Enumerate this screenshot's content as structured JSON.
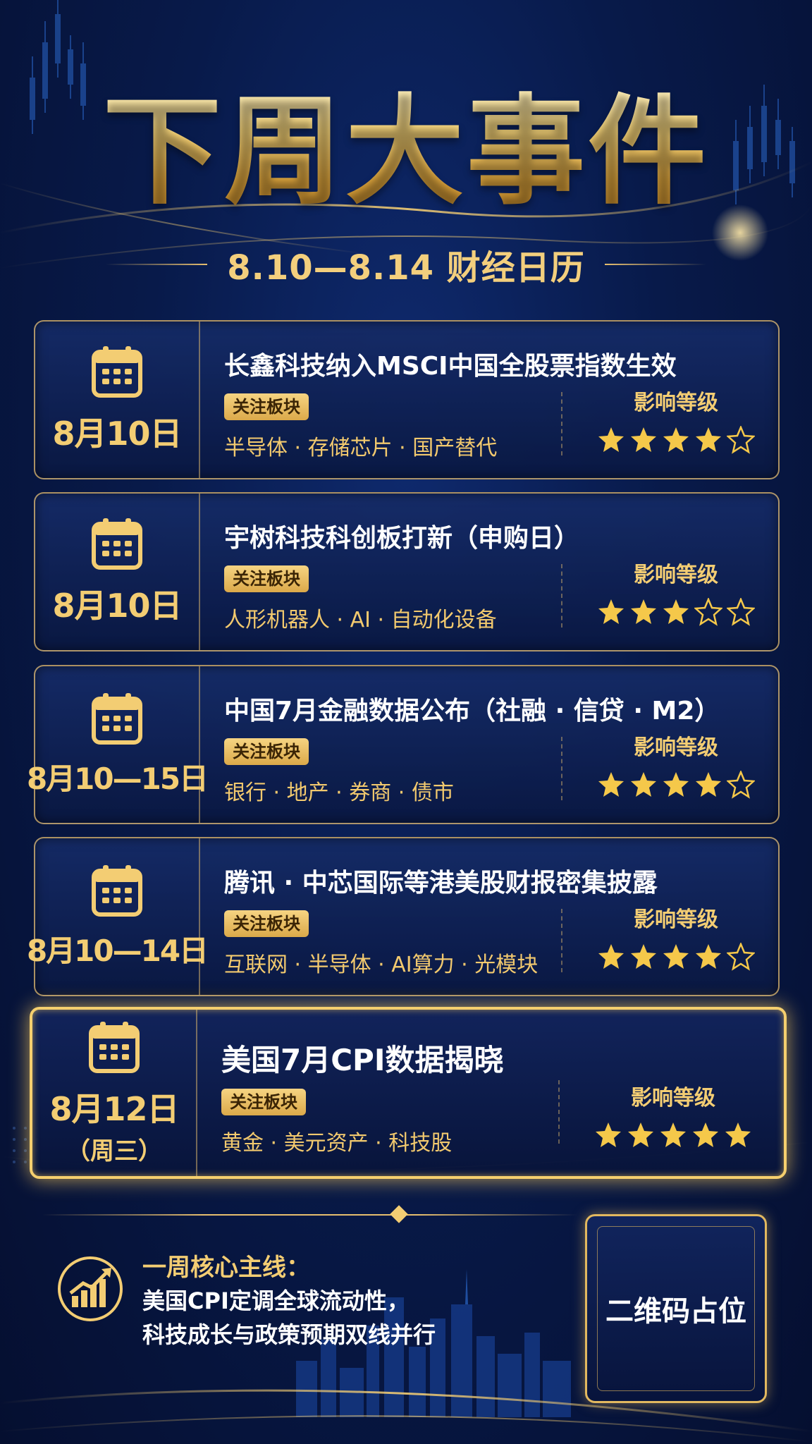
{
  "header": {
    "title": "下周大事件",
    "subtitle": "8.10—8.14 财经日历"
  },
  "events": [
    {
      "date": "8月10日",
      "date_sub": "",
      "title": "长鑫科技纳入MSCI中国全股票指数生效",
      "tag": "关注板块",
      "sectors": "半导体 · 存储芯片 · 国产替代",
      "impact_label": "影响等级",
      "rating": 4,
      "rating_max": 5
    },
    {
      "date": "8月10日",
      "date_sub": "",
      "title": "宇树科技科创板打新（申购日）",
      "tag": "关注板块",
      "sectors": "人形机器人 · AI · 自动化设备",
      "impact_label": "影响等级",
      "rating": 3,
      "rating_max": 5
    },
    {
      "date": "8月10—15日",
      "date_sub": "",
      "title": "中国7月金融数据公布（社融 · 信贷 · M2）",
      "tag": "关注板块",
      "sectors": "银行 · 地产 · 券商 · 债市",
      "impact_label": "影响等级",
      "rating": 4,
      "rating_max": 5
    },
    {
      "date": "8月10—14日",
      "date_sub": "",
      "title": "腾讯 · 中芯国际等港美股财报密集披露",
      "tag": "关注板块",
      "sectors": "互联网 · 半导体 · AI算力 · 光模块",
      "impact_label": "影响等级",
      "rating": 4,
      "rating_max": 5
    },
    {
      "date": "8月12日",
      "date_sub": "（周三）",
      "title": "美国7月CPI数据揭晓",
      "tag": "关注板块",
      "sectors": "黄金 · 美元资产 · 科技股",
      "impact_label": "影响等级",
      "rating": 5,
      "rating_max": 5
    }
  ],
  "footer": {
    "core_title": "一周核心主线：",
    "core_lines": [
      "美国CPI定调全球流动性，",
      "科技成长与政策预期双线并行"
    ],
    "qr_placeholder": "二维码占位"
  },
  "colors": {
    "gold": "#f3cd73",
    "tag_bg": "#dba94a",
    "background": "#081a4a",
    "star_filled": "#f5c84a"
  }
}
